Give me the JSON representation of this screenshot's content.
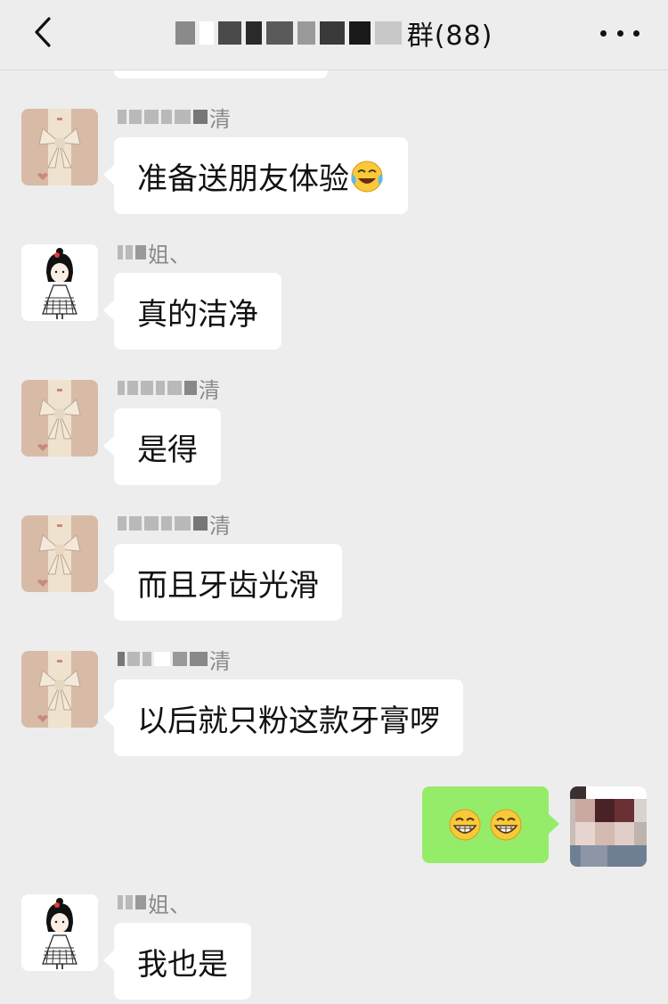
{
  "header": {
    "title_suffix": "群(88)",
    "back_icon": "chevron-left-icon",
    "more_icon": "more-dots-icon"
  },
  "colors": {
    "background": "#ededed",
    "incoming_bubble": "#ffffff",
    "outgoing_bubble": "#95ec69",
    "sender_name": "#8a8a8a"
  },
  "messages": [
    {
      "sender_visible": "清",
      "text": "准备送朋友体验",
      "emoji": "laughing-crying-emoji",
      "avatar": "ribbon-avatar"
    },
    {
      "sender_visible": "姐、",
      "text": "真的洁净",
      "avatar": "girl-cartoon-avatar"
    },
    {
      "sender_visible": "清",
      "text": "是得",
      "avatar": "ribbon-avatar"
    },
    {
      "sender_visible": "清",
      "text": "而且牙齿光滑",
      "avatar": "ribbon-avatar"
    },
    {
      "sender_visible": "清",
      "text": "以后就只粉这款牙膏啰",
      "avatar": "ribbon-avatar"
    },
    {
      "sender_visible": "",
      "text": "",
      "emoji": "grinning-emoji",
      "outgoing": true,
      "avatar": "self-avatar"
    },
    {
      "sender_visible": "姐、",
      "text": "我也是",
      "avatar": "girl-cartoon-avatar"
    }
  ]
}
